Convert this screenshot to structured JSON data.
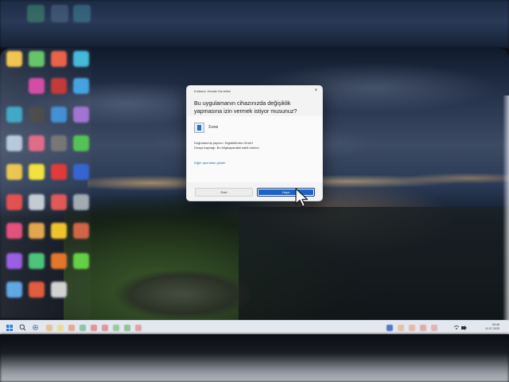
{
  "dialog": {
    "title": "Kullanıcı Hesabı Denetimi",
    "close_glyph": "×",
    "question": "Bu uygulamanın cihazınızda değişiklik yapmasına izin vermek istiyor musunuz?",
    "app_name": "3.exe",
    "publisher_line": "Doğrulanmış yayıncı: DigitalWorks GmbH",
    "origin_line": "Dosya kaynağı: Bu bilgisayardaki sabit sürücü",
    "more_details_link": "Diğer ayrıntıları göster",
    "yes_label": "Evet",
    "no_label": "Hayır"
  },
  "taskbar": {
    "time": "09:46",
    "date": "11.07.2025"
  },
  "icons": {
    "start": "windows-start-icon",
    "search": "search-icon",
    "settings": "settings-gear-icon",
    "shortcut": "desktop-shortcut-icon",
    "cursor": "mouse-pointer-icon"
  },
  "colors": {
    "accent": "#1c63c4",
    "dialog_bg": "#f3f3f3",
    "link": "#1f5fbf",
    "taskbar": "#e3e7ee"
  }
}
